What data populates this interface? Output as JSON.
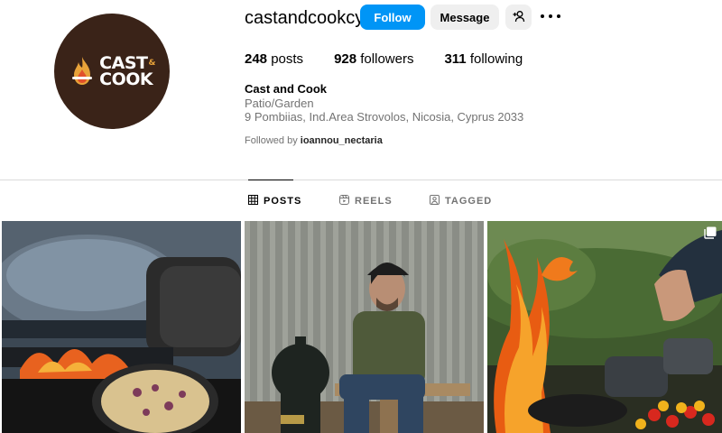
{
  "profile": {
    "username": "castandcookcy",
    "avatar_line1": "CAST",
    "avatar_amp": "&",
    "avatar_line2": "COOK",
    "follow_label": "Follow",
    "message_label": "Message",
    "stats": {
      "posts_count": "248",
      "posts_label": "posts",
      "followers_count": "928",
      "followers_label": "followers",
      "following_count": "311",
      "following_label": "following"
    },
    "full_name": "Cast and Cook",
    "category": "Patio/Garden",
    "address": "9 Pombiias, Ind.Area Strovolos, Nicosia, Cyprus 2033",
    "followed_by_prefix": "Followed by",
    "followed_by_user": "ioannou_nectaria"
  },
  "tabs": [
    {
      "label": "POSTS",
      "icon": "grid-icon",
      "active": true
    },
    {
      "label": "REELS",
      "icon": "reels-icon",
      "active": false
    },
    {
      "label": "TAGGED",
      "icon": "tagged-icon",
      "active": false
    }
  ],
  "colors": {
    "follow_button": "#0095f6",
    "secondary_button": "#efefef",
    "avatar_bg": "#3a2318",
    "muted_text": "#737373"
  },
  "posts": [
    {
      "icon": "none"
    },
    {
      "icon": "none"
    },
    {
      "icon": "multiple-photos-icon"
    }
  ]
}
